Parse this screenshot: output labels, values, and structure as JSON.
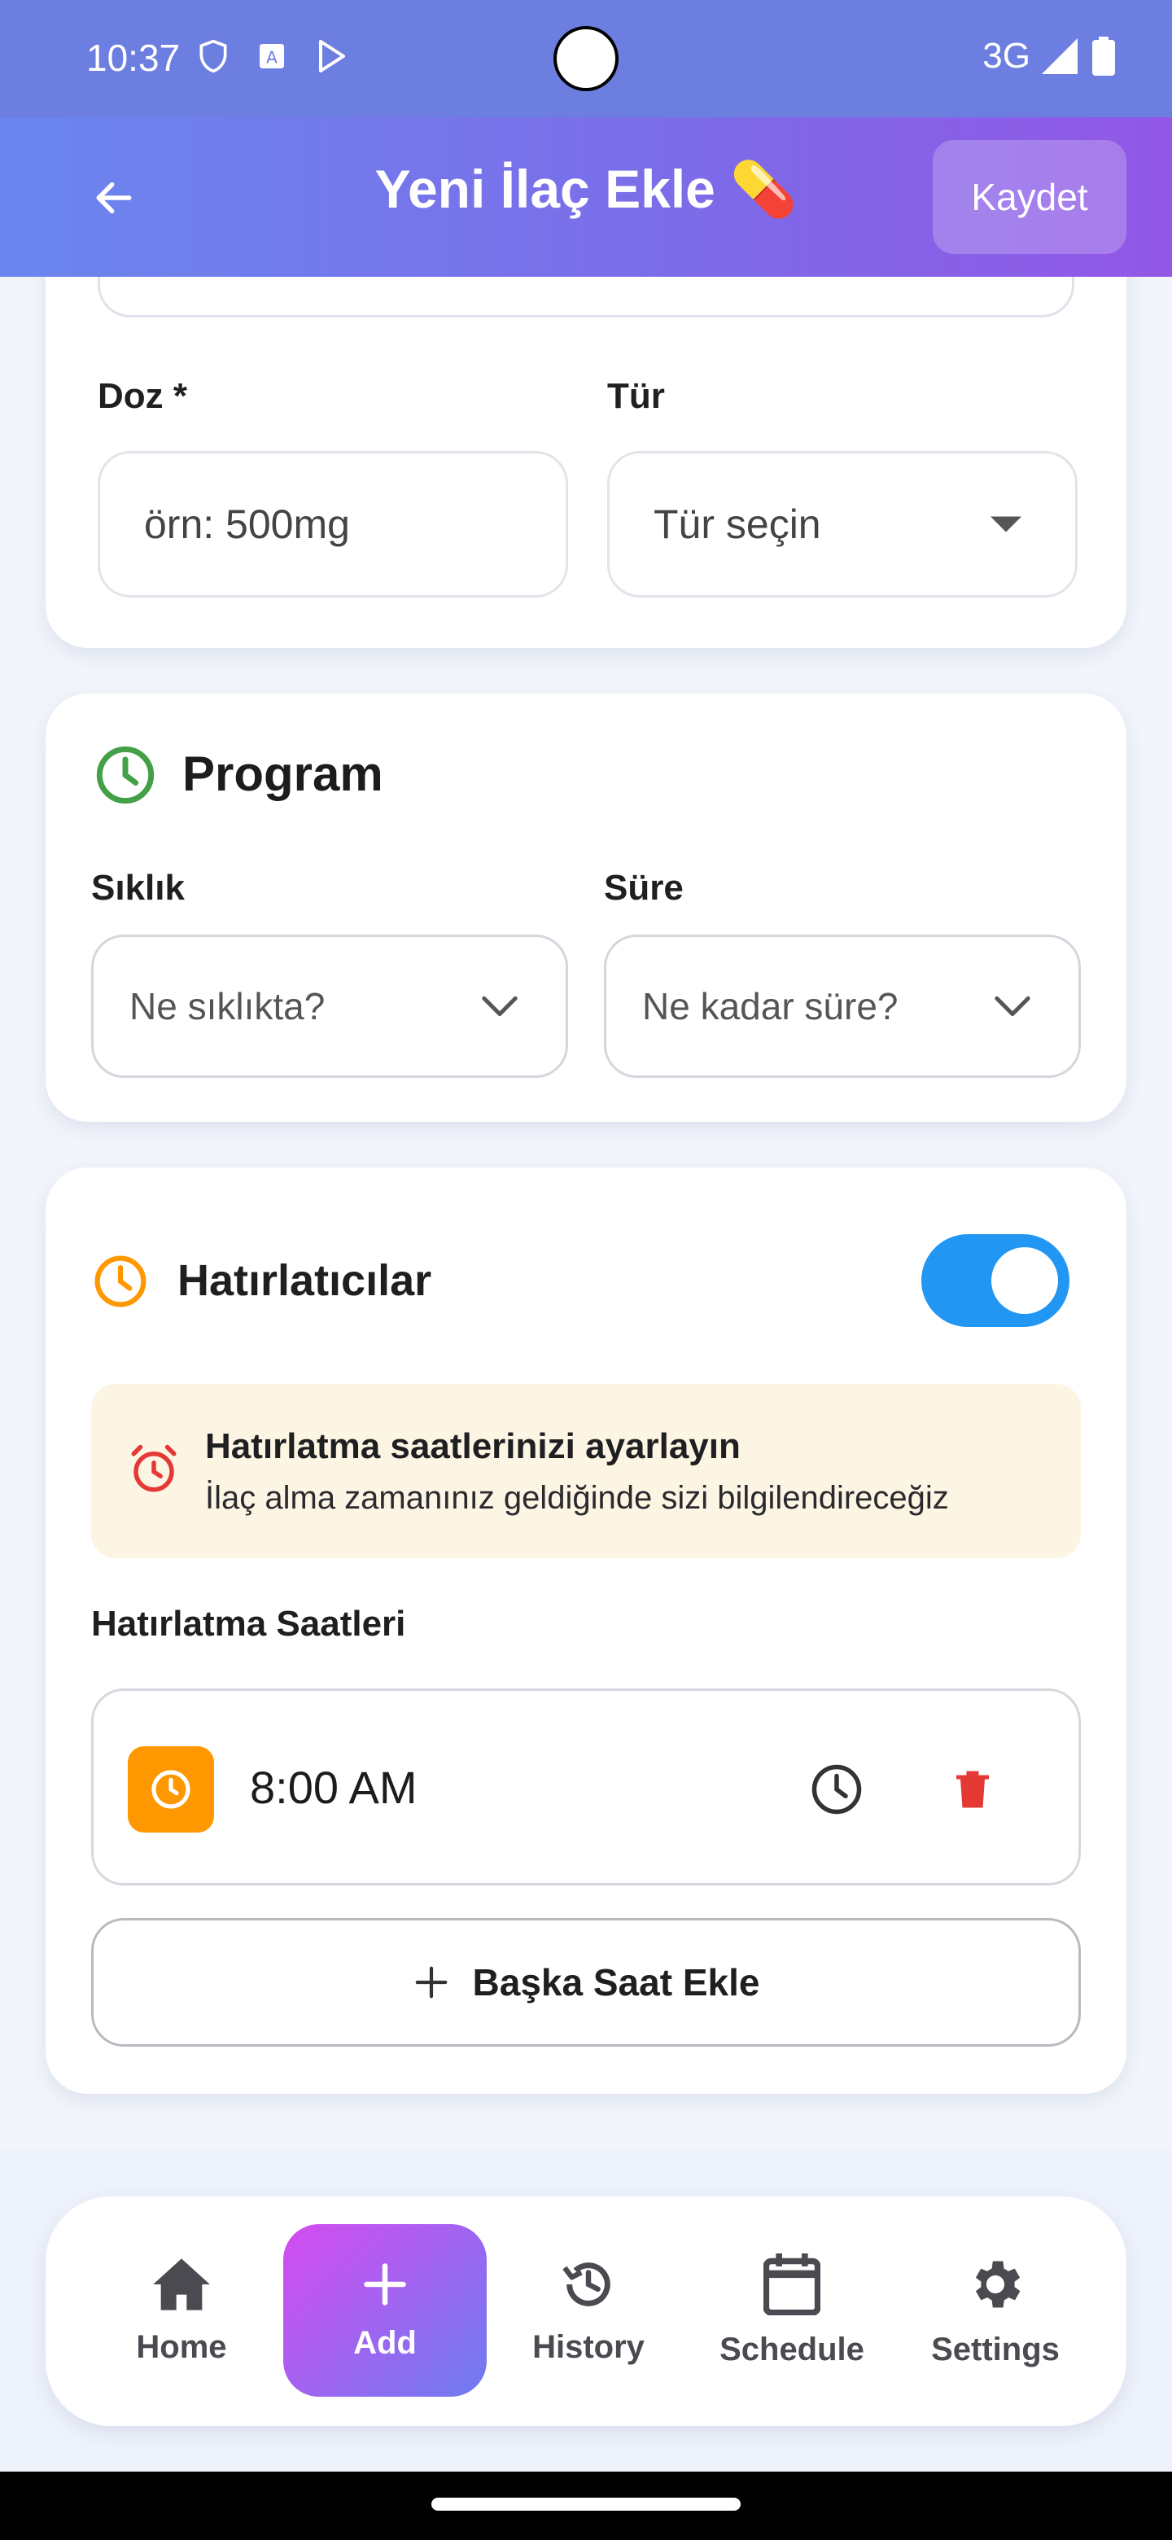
{
  "status_bar": {
    "time": "10:37",
    "network": "3G"
  },
  "app_bar": {
    "title": "Yeni İlaç Ekle 💊",
    "save_label": "Kaydet"
  },
  "dose_section": {
    "dose_label": "Doz *",
    "dose_placeholder": "örn: 500mg",
    "type_label": "Tür",
    "type_placeholder": "Tür seçin"
  },
  "program": {
    "title": "Program",
    "frequency_label": "Sıklık",
    "frequency_placeholder": "Ne sıklıkta?",
    "duration_label": "Süre",
    "duration_placeholder": "Ne kadar süre?"
  },
  "reminders": {
    "title": "Hatırlatıcılar",
    "enabled": true,
    "info_title": "Hatırlatma saatlerinizi ayarlayın",
    "info_text": "İlaç alma zamanınız geldiğinde sizi bilgilendireceğiz",
    "times_label": "Hatırlatma Saatleri",
    "times": [
      {
        "time": "8:00 AM"
      }
    ],
    "add_time_label": "Başka Saat Ekle"
  },
  "bottom_nav": [
    {
      "label": "Home",
      "icon": "home-icon"
    },
    {
      "label": "Add",
      "icon": "plus-icon",
      "active": true
    },
    {
      "label": "History",
      "icon": "history-icon"
    },
    {
      "label": "Schedule",
      "icon": "calendar-icon"
    },
    {
      "label": "Settings",
      "icon": "gear-icon"
    }
  ],
  "colors": {
    "accent_blue": "#2196f3",
    "reminder_orange": "#ff9800",
    "program_green": "#43a047",
    "delete_red": "#e53935",
    "info_bg": "#fdf5e4"
  }
}
